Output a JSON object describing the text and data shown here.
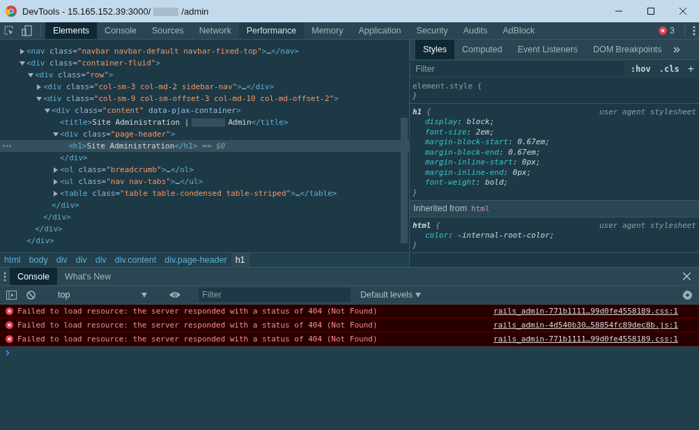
{
  "window": {
    "title_prefix": "DevTools - 15.165.152.39:3000/",
    "title_suffix": "/admin"
  },
  "main_tabs": [
    {
      "label": "Elements",
      "selected": true,
      "hovered": false
    },
    {
      "label": "Console",
      "selected": false,
      "hovered": false
    },
    {
      "label": "Sources",
      "selected": false,
      "hovered": false
    },
    {
      "label": "Network",
      "selected": false,
      "hovered": false
    },
    {
      "label": "Performance",
      "selected": false,
      "hovered": true
    },
    {
      "label": "Memory",
      "selected": false,
      "hovered": false
    },
    {
      "label": "Application",
      "selected": false,
      "hovered": false
    },
    {
      "label": "Security",
      "selected": false,
      "hovered": false
    },
    {
      "label": "Audits",
      "selected": false,
      "hovered": false
    },
    {
      "label": "AdBlock",
      "selected": false,
      "hovered": false
    }
  ],
  "error_count": "3",
  "elements": {
    "tree": [
      {
        "selected": false,
        "expanded": false,
        "open": [
          {
            "kind": "tag",
            "text": "<nav"
          },
          {
            "kind": "attr",
            "text": " class="
          },
          {
            "kind": "value",
            "text": "\"navbar navbar-default navbar-fixed-top\""
          },
          {
            "kind": "tag",
            "text": ">"
          },
          {
            "kind": "text",
            "text": "…"
          },
          {
            "kind": "tag",
            "text": "</nav>"
          }
        ]
      },
      {
        "selected": false,
        "expanded": true,
        "open": [
          {
            "kind": "tag",
            "text": "<div"
          },
          {
            "kind": "attr",
            "text": " class="
          },
          {
            "kind": "value",
            "text": "\"container-fluid\""
          },
          {
            "kind": "tag",
            "text": ">"
          }
        ],
        "close": [
          {
            "kind": "tag",
            "text": "</div>"
          }
        ],
        "children": [
          {
            "selected": false,
            "expanded": true,
            "open": [
              {
                "kind": "tag",
                "text": "<div"
              },
              {
                "kind": "attr",
                "text": " class="
              },
              {
                "kind": "value",
                "text": "\"row\""
              },
              {
                "kind": "tag",
                "text": ">"
              }
            ],
            "close": [
              {
                "kind": "tag",
                "text": "</div>"
              }
            ],
            "children": [
              {
                "selected": false,
                "expanded": false,
                "open": [
                  {
                    "kind": "tag",
                    "text": "<div"
                  },
                  {
                    "kind": "attr",
                    "text": " class="
                  },
                  {
                    "kind": "value",
                    "text": "\"col-sm-3 col-md-2 sidebar-nav\""
                  },
                  {
                    "kind": "tag",
                    "text": ">"
                  },
                  {
                    "kind": "text",
                    "text": "…"
                  },
                  {
                    "kind": "tag",
                    "text": "</div>"
                  }
                ]
              },
              {
                "selected": false,
                "expanded": true,
                "open": [
                  {
                    "kind": "tag",
                    "text": "<div"
                  },
                  {
                    "kind": "attr",
                    "text": " class="
                  },
                  {
                    "kind": "value",
                    "text": "\"col-sm-9 col-sm-offset-3 col-md-10 col-md-offset-2\""
                  },
                  {
                    "kind": "tag",
                    "text": ">"
                  }
                ],
                "close": [
                  {
                    "kind": "tag",
                    "text": "</div>"
                  }
                ],
                "children": [
                  {
                    "selected": false,
                    "expanded": true,
                    "open": [
                      {
                        "kind": "tag",
                        "text": "<div"
                      },
                      {
                        "kind": "attr",
                        "text": " class="
                      },
                      {
                        "kind": "value",
                        "text": "\"content\""
                      },
                      {
                        "kind": "attr",
                        "text": " data-pjax-container"
                      },
                      {
                        "kind": "tag",
                        "text": ">"
                      }
                    ],
                    "close": [
                      {
                        "kind": "tag",
                        "text": "</div>"
                      }
                    ],
                    "children": [
                      {
                        "selected": false,
                        "open": [
                          {
                            "kind": "tag",
                            "text": "<title>"
                          },
                          {
                            "kind": "text",
                            "text": "Site Administration |"
                          },
                          {
                            "kind": "redacted"
                          },
                          {
                            "kind": "text",
                            "text": "Admin"
                          },
                          {
                            "kind": "tag",
                            "text": "</title>"
                          }
                        ]
                      },
                      {
                        "selected": false,
                        "expanded": true,
                        "open": [
                          {
                            "kind": "tag",
                            "text": "<div"
                          },
                          {
                            "kind": "attr",
                            "text": " class="
                          },
                          {
                            "kind": "value",
                            "text": "\"page-header\""
                          },
                          {
                            "kind": "tag",
                            "text": ">"
                          }
                        ],
                        "close": [
                          {
                            "kind": "tag",
                            "text": "</div>"
                          }
                        ],
                        "children": [
                          {
                            "selected": true,
                            "open": [
                              {
                                "kind": "tag",
                                "text": "<h1>"
                              },
                              {
                                "kind": "text",
                                "text": "Site Administration"
                              },
                              {
                                "kind": "tag",
                                "text": "</h1>"
                              },
                              {
                                "kind": "ref",
                                "text": " == $0"
                              }
                            ]
                          }
                        ]
                      },
                      {
                        "selected": false,
                        "expanded": false,
                        "open": [
                          {
                            "kind": "tag",
                            "text": "<ol"
                          },
                          {
                            "kind": "attr",
                            "text": " class="
                          },
                          {
                            "kind": "value",
                            "text": "\"breadcrumb\""
                          },
                          {
                            "kind": "tag",
                            "text": ">"
                          },
                          {
                            "kind": "text",
                            "text": "…"
                          },
                          {
                            "kind": "tag",
                            "text": "</ol>"
                          }
                        ]
                      },
                      {
                        "selected": false,
                        "expanded": false,
                        "open": [
                          {
                            "kind": "tag",
                            "text": "<ul"
                          },
                          {
                            "kind": "attr",
                            "text": " class="
                          },
                          {
                            "kind": "value",
                            "text": "\"nav nav-tabs\""
                          },
                          {
                            "kind": "tag",
                            "text": ">"
                          },
                          {
                            "kind": "text",
                            "text": "…"
                          },
                          {
                            "kind": "tag",
                            "text": "</ul>"
                          }
                        ]
                      },
                      {
                        "selected": false,
                        "expanded": false,
                        "open": [
                          {
                            "kind": "tag",
                            "text": "<table"
                          },
                          {
                            "kind": "attr",
                            "text": " class="
                          },
                          {
                            "kind": "value",
                            "text": "\"table table-condensed table-striped\""
                          },
                          {
                            "kind": "tag",
                            "text": ">"
                          },
                          {
                            "kind": "text",
                            "text": "…"
                          },
                          {
                            "kind": "tag",
                            "text": "</table>"
                          }
                        ]
                      }
                    ]
                  }
                ]
              }
            ]
          }
        ]
      }
    ],
    "breadcrumbs": [
      {
        "label": "html",
        "selected": false
      },
      {
        "label": "body",
        "selected": false
      },
      {
        "label": "div",
        "selected": false
      },
      {
        "label": "div",
        "selected": false
      },
      {
        "label": "div",
        "selected": false
      },
      {
        "label": "div.content",
        "selected": false
      },
      {
        "label": "div.page-header",
        "selected": false
      },
      {
        "label": "h1",
        "selected": true
      }
    ]
  },
  "styles": {
    "tabs": [
      {
        "label": "Styles",
        "selected": true
      },
      {
        "label": "Computed",
        "selected": false
      },
      {
        "label": "Event Listeners",
        "selected": false
      },
      {
        "label": "DOM Breakpoints",
        "selected": false
      }
    ],
    "filter": {
      "placeholder": "Filter"
    },
    "hov": ":hov",
    "cls": ".cls",
    "add": "+",
    "sections": [
      {
        "kind": "rule",
        "selector": "element.style {",
        "close": "}"
      },
      {
        "kind": "rule",
        "selector": "h1",
        "brace": " {",
        "source": "user agent stylesheet",
        "properties": [
          {
            "name": "display",
            "rest": ": block;"
          },
          {
            "name": "font-size",
            "rest": ": 2em;"
          },
          {
            "name": "margin-block-start",
            "rest": ": 0.67em;"
          },
          {
            "name": "margin-block-end",
            "rest": ": 0.67em;"
          },
          {
            "name": "margin-inline-start",
            "rest": ": 0px;"
          },
          {
            "name": "margin-inline-end",
            "rest": ": 0px;"
          },
          {
            "name": "font-weight",
            "rest": ": bold;"
          }
        ],
        "close": "}"
      },
      {
        "kind": "inherited",
        "label": "Inherited from",
        "element": "html"
      },
      {
        "kind": "rule",
        "selector": "html",
        "brace": " {",
        "source": "user agent stylesheet",
        "properties": [
          {
            "name": "color",
            "rest": ": -internal-root-color;"
          }
        ],
        "close": "}"
      }
    ]
  },
  "drawer": {
    "tabs": [
      {
        "label": "Console",
        "selected": true
      },
      {
        "label": "What's New",
        "selected": false
      }
    ],
    "context": "top",
    "filter": {
      "placeholder": "Filter"
    },
    "levels": "Default levels",
    "messages": [
      {
        "kind": "error",
        "text": "Failed to load resource: the server responded with a status of 404 (Not Found)",
        "source": "rails_admin-771b1111…99d0fe4558189.css:1"
      },
      {
        "kind": "error",
        "text": "Failed to load resource: the server responded with a status of 404 (Not Found)",
        "source": "rails_admin-4d540b30…58854fc89dec8b.js:1"
      },
      {
        "kind": "error",
        "text": "Failed to load resource: the server responded with a status of 404 (Not Found)",
        "source": "rails_admin-771b1111…99d0fe4558189.css:1"
      }
    ]
  }
}
